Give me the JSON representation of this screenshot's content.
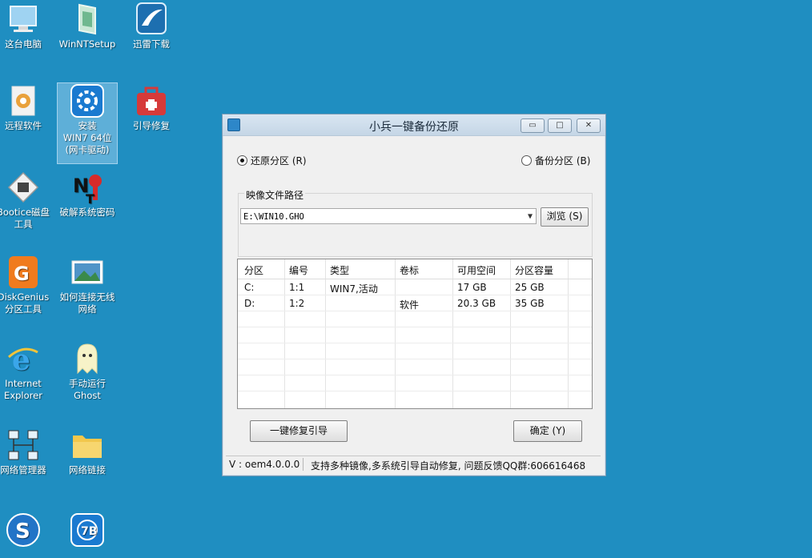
{
  "desktop": {
    "icons": [
      {
        "label": "这台电脑"
      },
      {
        "label": "WinNTSetup"
      },
      {
        "label": "迅雷下载"
      },
      {
        "label": "远程软件"
      },
      {
        "label": "安装\nWIN7 64位\n(网卡驱动)"
      },
      {
        "label": "引导修复"
      },
      {
        "label": "Bootice磁盘\n工具"
      },
      {
        "label": "破解系统密码"
      },
      {
        "label": "DiskGenius\n分区工具"
      },
      {
        "label": "如何连接无线\n网络"
      },
      {
        "label": "Internet\nExplorer"
      },
      {
        "label": "手动运行\nGhost"
      },
      {
        "label": "网络管理器"
      },
      {
        "label": "网络链接"
      }
    ]
  },
  "dialog": {
    "title": "小兵一键备份还原",
    "restore_label": "还原分区 (R)",
    "backup_label": "备份分区 (B)",
    "path_group_label": "映像文件路径",
    "path_value": "E:\\WIN10.GHO",
    "browse_label": "浏览 (S)",
    "table": {
      "headers": [
        "分区",
        "编号",
        "类型",
        "卷标",
        "可用空间",
        "分区容量"
      ],
      "rows": [
        [
          "C:",
          "1:1",
          "WIN7,活动",
          "",
          "17 GB",
          "25 GB"
        ],
        [
          "D:",
          "1:2",
          "",
          "软件",
          "20.3 GB",
          "35 GB"
        ]
      ]
    },
    "repair_button": "一键修复引导",
    "ok_button": "确定 (Y)",
    "status_version": "V : oem4.0.0.0",
    "status_message": "支持多种镜像,多系统引导自动修复, 问题反馈QQ群:606616468"
  }
}
